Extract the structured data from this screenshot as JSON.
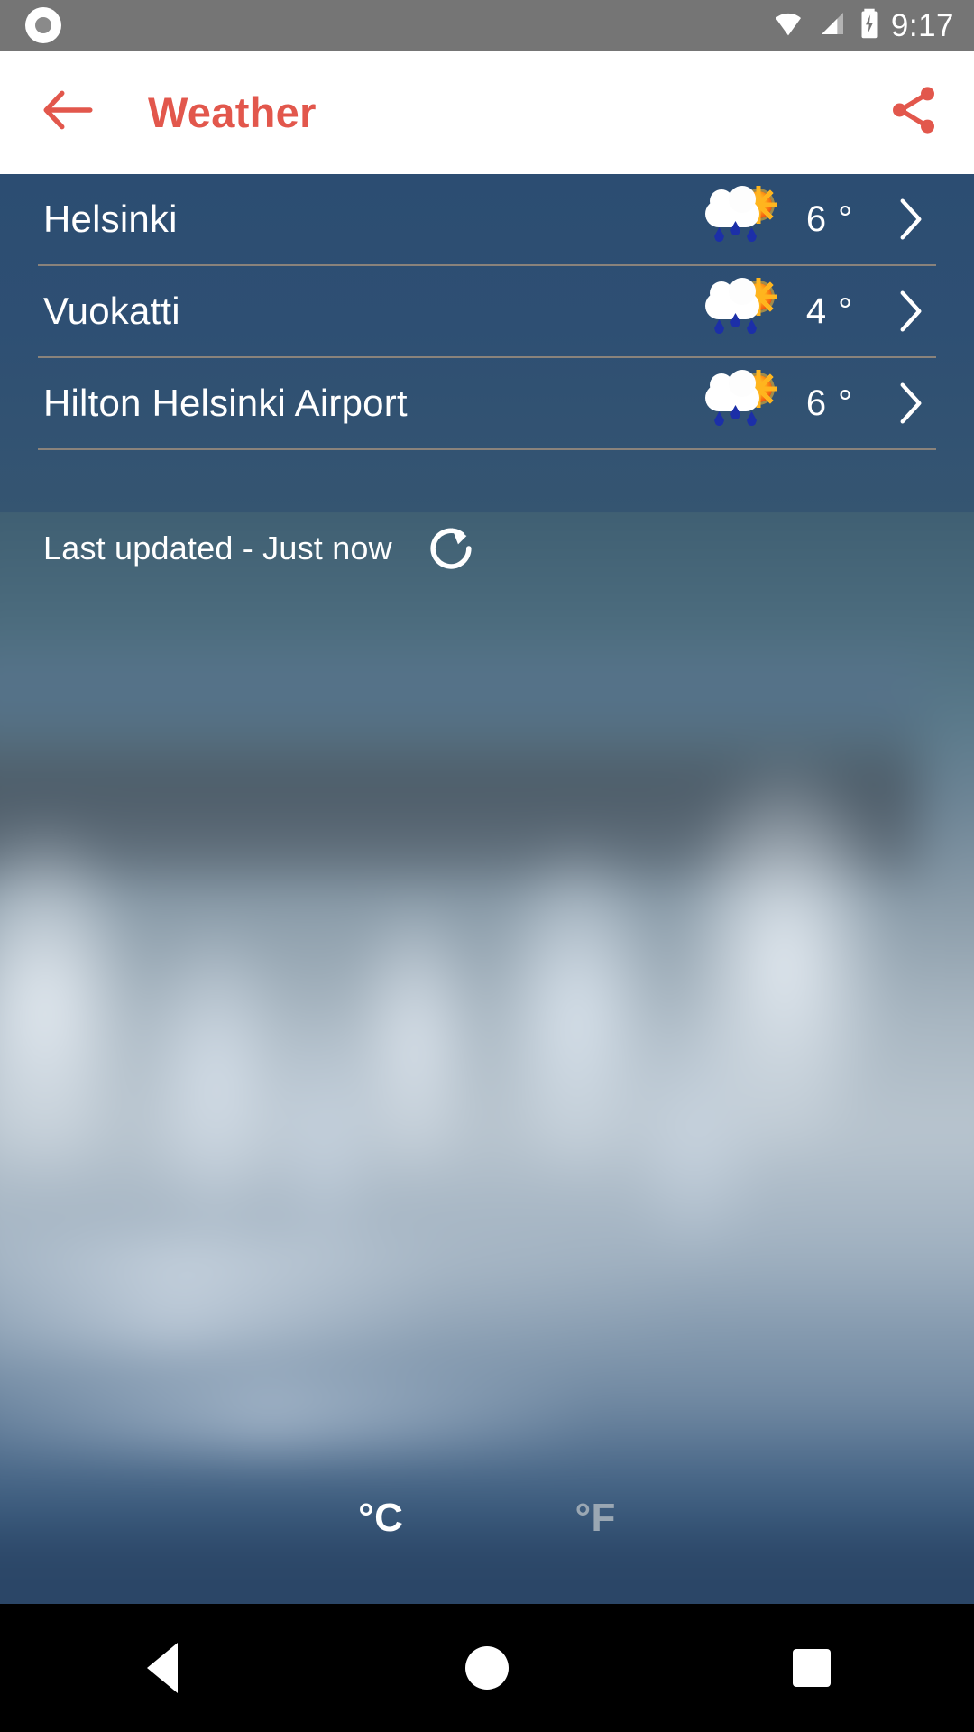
{
  "status_bar": {
    "time": "9:17",
    "icons": [
      "record-circle-icon",
      "wifi-icon",
      "cell-signal-icon",
      "battery-charging-icon"
    ],
    "background_color": "#757575"
  },
  "app_bar": {
    "title": "Weather",
    "accent_color": "#E2574C",
    "background_color": "#FFFFFF",
    "back_icon": "arrow-left-icon",
    "share_icon": "share-icon"
  },
  "cities": [
    {
      "name": "Helsinki",
      "temperature": "6 °",
      "weather_icon": "sun-behind-rain-cloud-icon",
      "chevron": "chevron-right-icon"
    },
    {
      "name": "Vuokatti",
      "temperature": "4 °",
      "weather_icon": "sun-behind-rain-cloud-icon",
      "chevron": "chevron-right-icon"
    },
    {
      "name": "Hilton Helsinki Airport",
      "temperature": "6 °",
      "weather_icon": "sun-behind-rain-cloud-icon",
      "chevron": "chevron-right-icon"
    }
  ],
  "last_updated": {
    "text": "Last updated - Just now",
    "refresh_icon": "refresh-icon"
  },
  "unit_toggle": {
    "celsius_label": "°C",
    "fahrenheit_label": "°F",
    "selected": "°C",
    "selected_color": "#FFFFFF",
    "unselected_color": "#9AA7B3"
  },
  "nav_bar": {
    "back_icon": "nav-back-triangle-icon",
    "home_icon": "nav-home-circle-icon",
    "recents_icon": "nav-recents-square-icon",
    "background_color": "#000000"
  },
  "theme": {
    "list_background": "#2C4D72",
    "divider_color": "#9A8C7C",
    "text_color": "#FFFFFF"
  }
}
